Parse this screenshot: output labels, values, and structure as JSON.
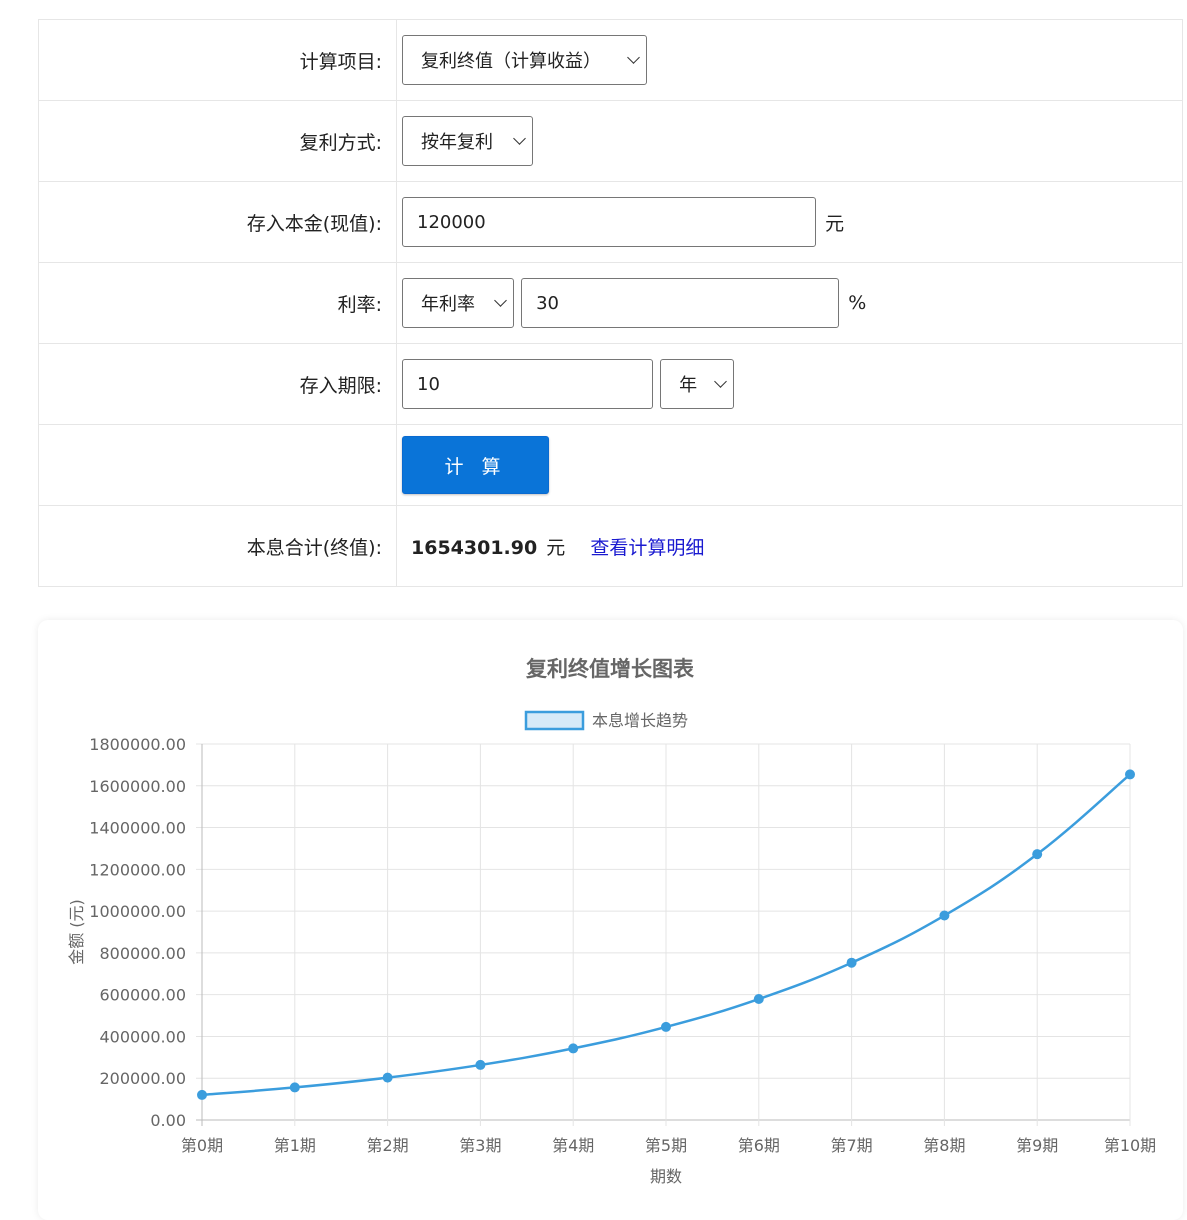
{
  "form": {
    "calc_item_label": "计算项目:",
    "calc_item_value": "复利终值（计算收益）",
    "compound_label": "复利方式:",
    "compound_value": "按年复利",
    "principal_label": "存入本金(现值):",
    "principal_value": "120000",
    "principal_unit": "元",
    "rate_label": "利率:",
    "rate_type_value": "年利率",
    "rate_value": "30",
    "rate_unit": "%",
    "term_label": "存入期限:",
    "term_value": "10",
    "term_unit_value": "年",
    "calculate_button": "计 算",
    "result_label": "本息合计(终值):",
    "result_value": "1654301.90",
    "result_unit": "元",
    "detail_link": "查看计算明细"
  },
  "colors": {
    "accent": "#0a74d8",
    "link": "#1a1ad0",
    "result_label": "#e01010",
    "series_line": "#3b9ddd",
    "series_fill": "#d6eaf8"
  },
  "chart_data": {
    "type": "line",
    "title": "复利终值增长图表",
    "legend": [
      "本息增长趋势"
    ],
    "legend_position": "top-center",
    "xlabel": "期数",
    "ylabel": "金额 (元)",
    "ylim": [
      0,
      1800000
    ],
    "y_ticks": [
      "0.00",
      "200000.00",
      "400000.00",
      "600000.00",
      "800000.00",
      "1000000.00",
      "1200000.00",
      "1400000.00",
      "1600000.00",
      "1800000.00"
    ],
    "grid": true,
    "categories": [
      "第0期",
      "第1期",
      "第2期",
      "第3期",
      "第4期",
      "第5期",
      "第6期",
      "第7期",
      "第8期",
      "第9期",
      "第10期"
    ],
    "series": [
      {
        "name": "本息增长趋势",
        "values": [
          120000,
          156000,
          202800,
          263640,
          342732,
          445551.6,
          579217.08,
          752982.2,
          978876.87,
          1272539.93,
          1654301.9
        ]
      }
    ]
  }
}
